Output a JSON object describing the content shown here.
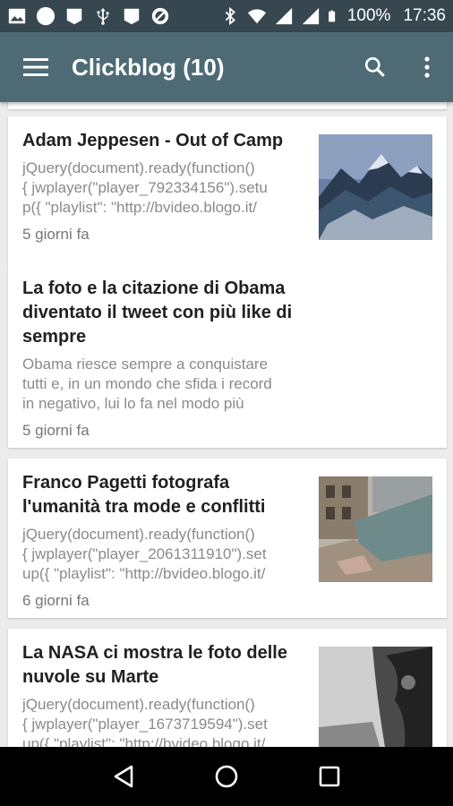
{
  "status_bar": {
    "battery_percent": "100%",
    "time": "17:36",
    "icons": [
      "image-icon",
      "circle-icon",
      "notification-icon",
      "usb-icon",
      "notification-icon",
      "block-icon",
      "bluetooth-icon",
      "wifi-icon",
      "signal-icon",
      "signal-icon",
      "battery-icon"
    ]
  },
  "app_bar": {
    "title": "Clickblog (10)",
    "background": "#4e6b75",
    "icons": [
      "menu-icon",
      "search-icon",
      "overflow-menu-icon"
    ]
  },
  "feed": {
    "items": [
      {
        "title_lines": [
          "Adam Jeppesen - Out of Camp"
        ],
        "excerpt_lines": [
          "jQuery(document).ready(function()",
          "{ jwplayer(\"player_792334156\").setu",
          "p({ \"playlist\": \"http://bvideo.blogo.it/"
        ],
        "date": "5 giorni fa",
        "thumbnail": "mountain-image"
      },
      {
        "title_lines": [
          "La foto e la citazione di Obama",
          "diventato il tweet con più like di",
          "sempre"
        ],
        "excerpt_lines": [
          "Obama riesce sempre a conquistare",
          "tutti e, in un mondo che sfida i record",
          "in negativo, lui lo fa nel modo più"
        ],
        "date": "5 giorni fa",
        "thumbnail": null
      },
      {
        "title_lines": [
          "Franco Pagetti fotografa",
          "l'umanità tra mode e conflitti"
        ],
        "excerpt_lines": [
          "jQuery(document).ready(function()",
          "{ jwplayer(\"player_2061311910\").set",
          "up({ \"playlist\": \"http://bvideo.blogo.it/"
        ],
        "date": "6 giorni fa",
        "thumbnail": "ruins-image"
      },
      {
        "title_lines": [
          "La NASA ci mostra le foto delle",
          "nuvole su Marte"
        ],
        "excerpt_lines": [
          "jQuery(document).ready(function()",
          "{ jwplayer(\"player_1673719594\").set",
          "up({ \"playlist\": \"http://bvideo.blogo.it/"
        ],
        "date": "",
        "thumbnail": "mars-image"
      }
    ]
  },
  "nav_bar": {
    "icons": [
      "back-icon",
      "home-icon",
      "recents-icon"
    ]
  }
}
